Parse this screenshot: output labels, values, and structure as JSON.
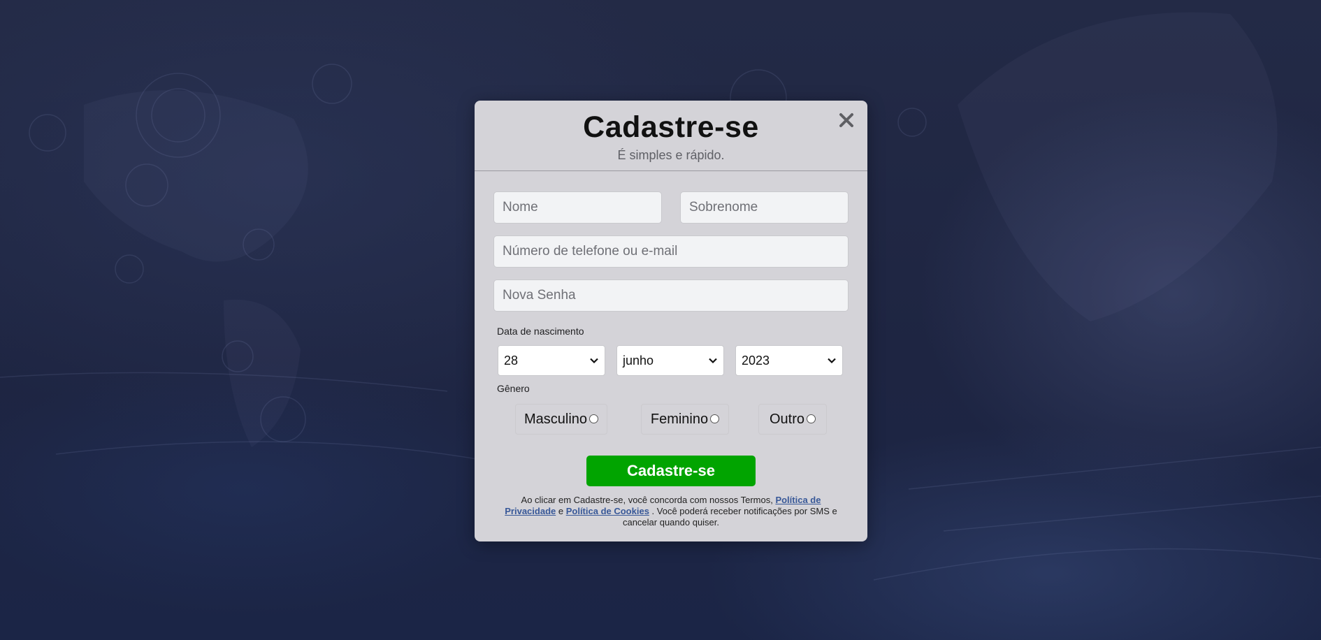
{
  "modal": {
    "title": "Cadastre-se",
    "subtitle": "É simples e rápido.",
    "close_symbol": "×"
  },
  "form": {
    "first_name": {
      "placeholder": "Nome",
      "value": ""
    },
    "last_name": {
      "placeholder": "Sobrenome",
      "value": ""
    },
    "contact": {
      "placeholder": "Número de telefone ou e-mail",
      "value": ""
    },
    "password": {
      "placeholder": "Nova Senha",
      "value": ""
    },
    "birthdate": {
      "label": "Data de nascimento",
      "day": "28",
      "month": "junho",
      "year": "2023"
    },
    "gender": {
      "label": "Gênero",
      "options": [
        {
          "label": "Masculino",
          "checked": false
        },
        {
          "label": "Feminino",
          "checked": false
        },
        {
          "label": "Outro",
          "checked": false
        }
      ]
    },
    "submit_label": "Cadastre-se"
  },
  "terms": {
    "text_before": "Ao clicar em Cadastre-se, você concorda com nossos Termos, ",
    "privacy_link": "Política de Privacidade",
    "connector": " e ",
    "cookies_link": "Política de Cookies",
    "text_after": " . Você poderá receber notificações por SMS e cancelar quando quiser."
  },
  "colors": {
    "modal_bg": "#d4d3d8",
    "submit_bg": "#01a400",
    "link": "#385898",
    "page_bg": "#1c2440"
  },
  "icons": {
    "close": "close-icon",
    "select_arrow": "chevron-down-icon"
  }
}
